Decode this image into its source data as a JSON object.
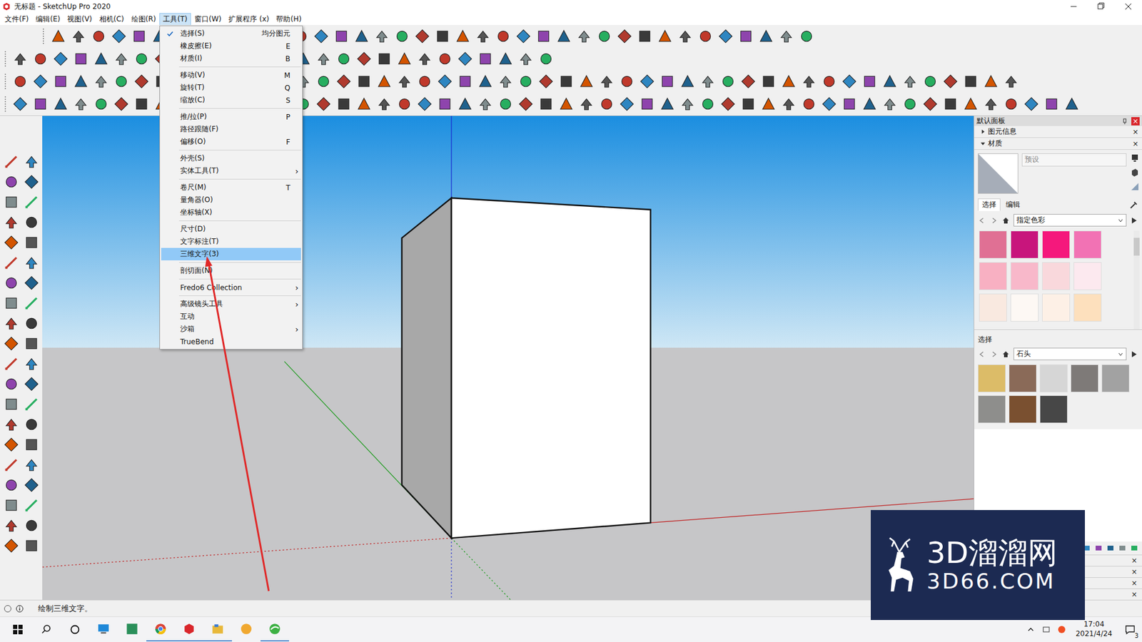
{
  "window": {
    "title": "无标题 - SketchUp Pro 2020"
  },
  "menubar": [
    {
      "label": "文件(F)",
      "selected": false
    },
    {
      "label": "编辑(E)",
      "selected": false
    },
    {
      "label": "视图(V)",
      "selected": false
    },
    {
      "label": "相机(C)",
      "selected": false
    },
    {
      "label": "绘图(R)",
      "selected": false
    },
    {
      "label": "工具(T)",
      "selected": true
    },
    {
      "label": "窗口(W)",
      "selected": false
    },
    {
      "label": "扩展程序 (x)",
      "selected": false
    },
    {
      "label": "帮助(H)",
      "selected": false
    }
  ],
  "tools_menu": {
    "submenu_glyph": "›",
    "groups": [
      [
        {
          "label": "选择(S)",
          "shortcut": "均分图元",
          "checked": true,
          "selected": false,
          "submenu": false
        },
        {
          "label": "橡皮擦(E)",
          "shortcut": "E",
          "checked": false,
          "selected": false,
          "submenu": false
        },
        {
          "label": "材质(I)",
          "shortcut": "B",
          "checked": false,
          "selected": false,
          "submenu": false
        }
      ],
      [
        {
          "label": "移动(V)",
          "shortcut": "M",
          "checked": false,
          "selected": false,
          "submenu": false
        },
        {
          "label": "旋转(T)",
          "shortcut": "Q",
          "checked": false,
          "selected": false,
          "submenu": false
        },
        {
          "label": "缩放(C)",
          "shortcut": "S",
          "checked": false,
          "selected": false,
          "submenu": false
        }
      ],
      [
        {
          "label": "推/拉(P)",
          "shortcut": "P",
          "checked": false,
          "selected": false,
          "submenu": false
        },
        {
          "label": "路径跟随(F)",
          "shortcut": "",
          "checked": false,
          "selected": false,
          "submenu": false
        },
        {
          "label": "偏移(O)",
          "shortcut": "F",
          "checked": false,
          "selected": false,
          "submenu": false
        }
      ],
      [
        {
          "label": "外壳(S)",
          "shortcut": "",
          "checked": false,
          "selected": false,
          "submenu": false
        },
        {
          "label": "实体工具(T)",
          "shortcut": "",
          "checked": false,
          "selected": false,
          "submenu": true
        }
      ],
      [
        {
          "label": "卷尺(M)",
          "shortcut": "T",
          "checked": false,
          "selected": false,
          "submenu": false
        },
        {
          "label": "量角器(O)",
          "shortcut": "",
          "checked": false,
          "selected": false,
          "submenu": false
        },
        {
          "label": "坐标轴(X)",
          "shortcut": "",
          "checked": false,
          "selected": false,
          "submenu": false
        }
      ],
      [
        {
          "label": "尺寸(D)",
          "shortcut": "",
          "checked": false,
          "selected": false,
          "submenu": false
        },
        {
          "label": "文字标注(T)",
          "shortcut": "",
          "checked": false,
          "selected": false,
          "submenu": false
        },
        {
          "label": "三维文字(3)",
          "shortcut": "",
          "checked": false,
          "selected": true,
          "submenu": false
        }
      ],
      [
        {
          "label": "剖切面(N)",
          "shortcut": "",
          "checked": false,
          "selected": false,
          "submenu": false
        }
      ],
      [
        {
          "label": "Fredo6 Collection",
          "shortcut": "",
          "checked": false,
          "selected": false,
          "submenu": true
        }
      ],
      [
        {
          "label": "高级镜头工具",
          "shortcut": "",
          "checked": false,
          "selected": false,
          "submenu": true
        },
        {
          "label": "互动",
          "shortcut": "",
          "checked": false,
          "selected": false,
          "submenu": false
        },
        {
          "label": "沙箱",
          "shortcut": "",
          "checked": false,
          "selected": false,
          "submenu": true
        },
        {
          "label": "TrueBend",
          "shortcut": "",
          "checked": false,
          "selected": false,
          "submenu": false
        }
      ]
    ]
  },
  "default_tray": {
    "title": "默认面板",
    "close_glyph": "×",
    "sections": [
      {
        "label": "图元信息",
        "expanded": false
      },
      {
        "label": "材质",
        "expanded": true
      }
    ]
  },
  "materials": {
    "name_placeholder": "预设",
    "tabs": [
      {
        "label": "选择",
        "selected": true
      },
      {
        "label": "编辑",
        "selected": false
      }
    ],
    "collection": "指定色彩",
    "swatches": [
      {
        "color": "#e07094"
      },
      {
        "color": "#c8157c"
      },
      {
        "color": "#f5187c"
      },
      {
        "color": "#f272b4"
      },
      {
        "color": "#f8b0c2"
      },
      {
        "color": "#f8b8ca"
      },
      {
        "color": "#f9d8dc"
      },
      {
        "color": "#fce9ef"
      },
      {
        "color": "#f9e9e0"
      },
      {
        "color": "#fdf8f4"
      },
      {
        "color": "#fdf0e6"
      },
      {
        "color": "#fde0bd"
      }
    ],
    "secondary_label": "选择",
    "secondary_collection": "石头",
    "secondary_swatches": [
      {
        "color": "#dcbc68"
      },
      {
        "color": "#8a6a58"
      },
      {
        "color": "#d6d6d6"
      },
      {
        "color": "#7e7a78"
      },
      {
        "color": "#a2a2a2"
      },
      {
        "color": "#8e8e8c"
      },
      {
        "color": "#7a5030"
      },
      {
        "color": "#474747"
      }
    ]
  },
  "status_bar": {
    "message": "绘制三维文字。"
  },
  "watermark": {
    "title": "3D溜溜网",
    "subtitle": "3D66.COM"
  },
  "taskbar": {
    "time": "17:04",
    "date": "2021/4/24",
    "notifications": "3"
  }
}
